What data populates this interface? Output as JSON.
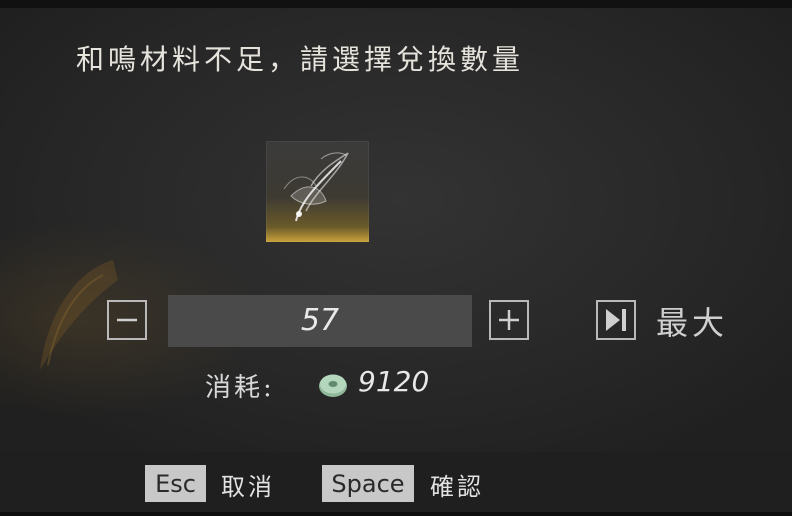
{
  "dialog": {
    "title": "和鳴材料不足，請選擇兌換數量",
    "item": {
      "icon": "feather-fan-item-icon"
    },
    "quantity": {
      "value": "57",
      "decrease_icon": "minus-icon",
      "increase_icon": "plus-icon"
    },
    "max": {
      "icon": "skip-to-end-icon",
      "label": "最大"
    },
    "cost": {
      "label": "消耗:",
      "currency_icon": "jade-coin-icon",
      "value": "9120"
    }
  },
  "footer": {
    "cancel": {
      "key": "Esc",
      "label": "取消"
    },
    "confirm": {
      "key": "Space",
      "label": "確認"
    }
  },
  "colors": {
    "background": "#2b2b2b",
    "field": "#4a4a4a",
    "accent_gold": "#c9a23a",
    "jade": "#8fb89a"
  }
}
